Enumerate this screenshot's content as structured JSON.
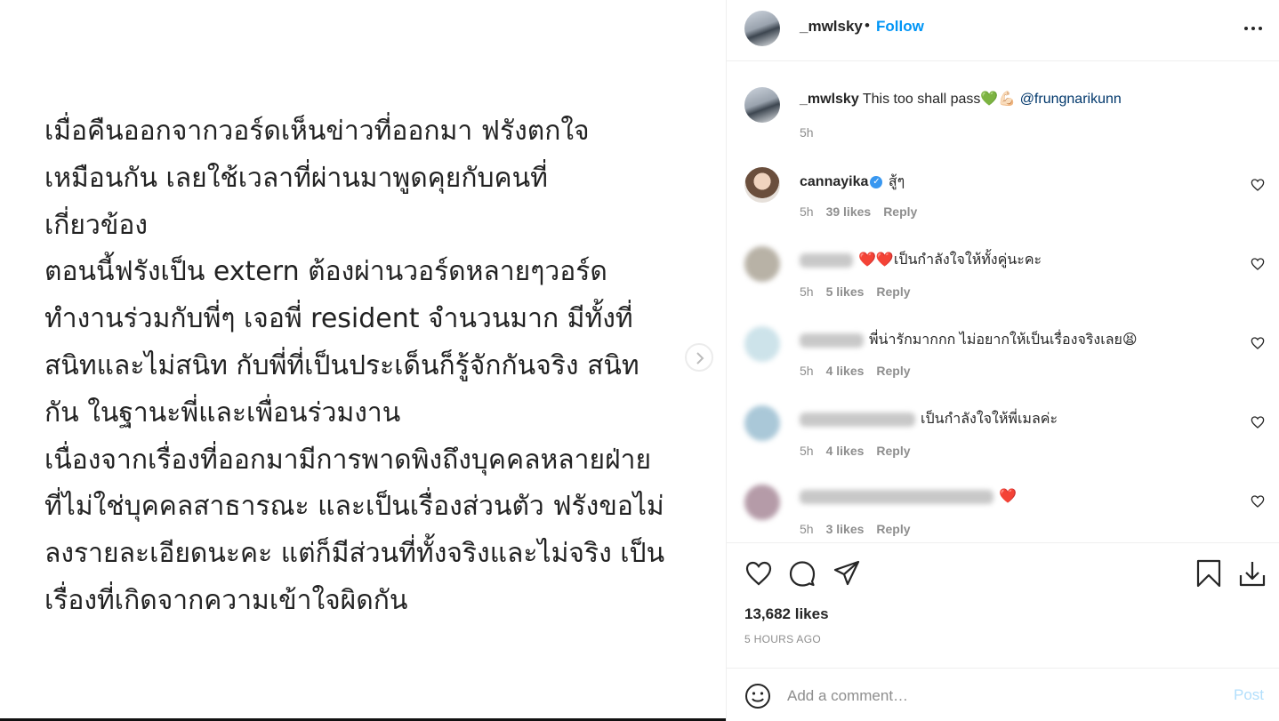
{
  "post_image": {
    "lines": [
      "เมื่อคืนออกจากวอร์ดเห็นข่าวที่ออกมา ฟรังตกใจ",
      "เหมือนกัน  เลยใช้เวลาที่ผ่านมาพูดคุยกับคนที่",
      "เกี่ยวข้อง",
      "ตอนนี้ฟรังเป็น extern ต้องผ่านวอร์ดหลายๆวอร์ด",
      "ทำงานร่วมกับพี่ๆ เจอพี่ resident จำนวนมาก มีทั้งที่",
      "สนิทและไม่สนิท กับพี่ที่เป็นประเด็นก็รู้จักกันจริง สนิท",
      "กัน  ในฐานะพี่และเพื่อนร่วมงาน",
      "เนื่องจากเรื่องที่ออกมามีการพาดพิงถึงบุคคลหลายฝ่าย",
      "ที่ไม่ใช่บุคคลสาธารณะ และเป็นเรื่องส่วนตัว ฟรังขอไม่",
      "ลงรายละเอียดนะคะ แต่ก็มีส่วนที่ทั้งจริงและไม่จริง เป็น",
      "เรื่องที่เกิดจากความเข้าใจผิดกัน"
    ]
  },
  "header": {
    "username": "_mwlsky",
    "separator": "•",
    "follow_label": "Follow",
    "more_icon": "more-options-icon"
  },
  "caption": {
    "username": "_mwlsky",
    "text": "This too shall pass",
    "emojis": "💚💪🏻",
    "mention": "@frungnarikunn",
    "time": "5h"
  },
  "comments": [
    {
      "username": "cannayika",
      "verified": true,
      "text": "สู้ๆ",
      "time": "5h",
      "likes": "39 likes",
      "reply": "Reply"
    },
    {
      "username": "",
      "text": "❤️❤️เป็นกำลังใจให้ทั้งคู่นะคะ",
      "time": "5h",
      "likes": "5 likes",
      "reply": "Reply"
    },
    {
      "username": "",
      "text": "พี่น่ารักมากกก ไม่อยากให้เป็นเรื่องจริงเลย😫",
      "time": "5h",
      "likes": "4 likes",
      "reply": "Reply"
    },
    {
      "username": "",
      "text": "เป็นกำลังใจให้พี่เมลค่ะ",
      "time": "5h",
      "likes": "4 likes",
      "reply": "Reply"
    },
    {
      "username": "",
      "text": "❤️",
      "time": "5h",
      "likes": "3 likes",
      "reply": "Reply"
    }
  ],
  "actions": {
    "likes_count": "13,682 likes",
    "time_ago": "5 HOURS AGO"
  },
  "add_comment": {
    "placeholder": "Add a comment…",
    "post_label": "Post"
  },
  "colors": {
    "accent": "#0095f6",
    "post_disabled": "#b2dffc",
    "muted": "#8e8e8e",
    "heart_red": "#ed4956"
  }
}
